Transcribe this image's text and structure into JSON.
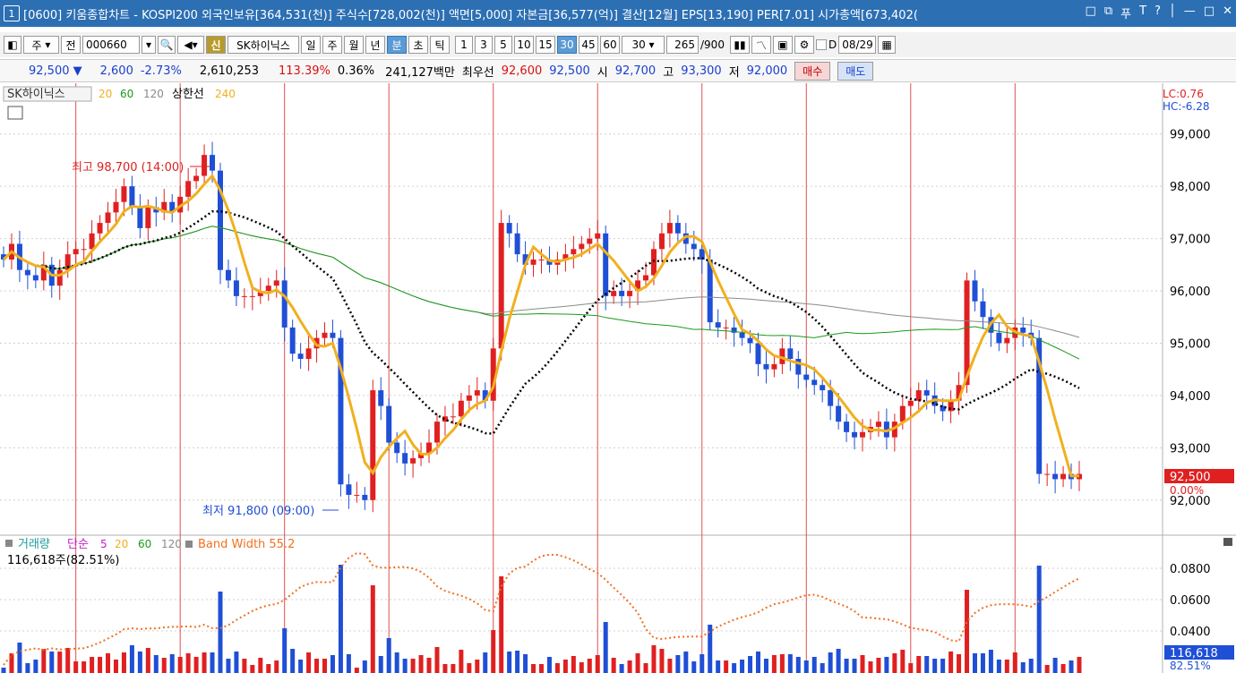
{
  "title_bar": {
    "screen_number": "1",
    "text": "[0600] 키움종합차트 - KOSPI200 외국인보유[364,531(천)] 주식수[728,002(천)] 액면[5,000] 자본금[36,577(억)] 결산[12월] EPS[13,190] PER[7.01] 시가총액[673,402(",
    "icons": [
      "□",
      "⧉",
      "푸",
      "T",
      "?",
      "│",
      "—",
      "□",
      "✕"
    ]
  },
  "toolbar": {
    "period_select": "주",
    "prev_label": "전",
    "stock_code": "000660",
    "new_label": "신",
    "stock_name": "SK하이닉스",
    "periods": [
      "일",
      "주",
      "월",
      "년",
      "분",
      "초",
      "틱"
    ],
    "selected_period": "분",
    "intervals": [
      "1",
      "3",
      "5",
      "10",
      "15",
      "30",
      "45",
      "60"
    ],
    "selected_interval": "30",
    "interval_select": "30",
    "count": "265",
    "count_total": "/900",
    "date_checkbox_label": "D",
    "date": "08/29"
  },
  "quote_bar": {
    "price": "92,500 ▼",
    "change": "2,600",
    "change_pct": "-2.73%",
    "volume": "2,610,253",
    "volume_ratio": "113.39%",
    "turnover": "0.36%",
    "amount": "241,127백만",
    "best_label": "최우선",
    "ask": "92,600",
    "bid": "92,500",
    "open_label": "시",
    "open": "92,700",
    "high_label": "고",
    "high": "93,300",
    "low_label": "저",
    "low": "92,000",
    "buy_button": "매수",
    "sell_button": "매도"
  },
  "price_panel": {
    "legend_name": "SK하이닉스",
    "legend_ma": [
      "20",
      "60",
      "120"
    ],
    "legend_limit": "상한선",
    "legend_limit_value": "240",
    "lc": "LC:0.76",
    "hc": "HC:-6.28",
    "high_annotation": "최고 98,700 (14:00)",
    "low_annotation": "최저 91,800 (09:00)",
    "current_price_tag": "92,500",
    "current_pct_tag": "0.00%",
    "colors": {
      "up": "#e02020",
      "down": "#1f4fd6",
      "ma_gold": "#f0b020",
      "ma_black": "#000000",
      "ma_green": "#1a9a1a",
      "ma_gray": "#8a8a8a"
    }
  },
  "volume_panel": {
    "legend_name": "거래량",
    "legend_simple": "단순",
    "legend_ma": [
      "5",
      "20",
      "60",
      "120"
    ],
    "legend_bw": "Band Width 55.2",
    "volume_value": "116,618주(82.51%)",
    "current_volume_tag": "116,618",
    "current_pct_tag": "82.51%"
  },
  "chart_data": {
    "type": "line",
    "price_axis": {
      "ticks": [
        "99,000",
        "98,000",
        "97,000",
        "96,000",
        "95,000",
        "94,000",
        "93,000",
        "92,000"
      ],
      "ylim": [
        91500,
        99800
      ]
    },
    "bandwidth_axis": {
      "ticks": [
        "0.0800",
        "0.0600",
        "0.0400"
      ]
    },
    "close": [
      96600,
      96900,
      96400,
      96300,
      96200,
      96500,
      96100,
      96400,
      96700,
      96800,
      96800,
      97100,
      97300,
      97500,
      97700,
      98000,
      97600,
      97200,
      97600,
      97500,
      97700,
      97500,
      97800,
      98100,
      98200,
      98600,
      98300,
      96400,
      96200,
      95900,
      95900,
      95900,
      96000,
      96100,
      96200,
      95300,
      94800,
      94700,
      94900,
      95100,
      95200,
      95100,
      92300,
      92100,
      92100,
      92000,
      94100,
      93800,
      93100,
      92900,
      92700,
      92800,
      92900,
      93100,
      93500,
      93600,
      93600,
      93900,
      94000,
      94100,
      93900,
      94900,
      97300,
      97100,
      96700,
      96500,
      96600,
      96600,
      96500,
      96600,
      96700,
      96800,
      96900,
      97000,
      97100,
      95900,
      96000,
      95900,
      96000,
      96200,
      96300,
      96800,
      97100,
      97300,
      97100,
      96900,
      96800,
      96600,
      95400,
      95300,
      95300,
      95200,
      95100,
      95000,
      94600,
      94500,
      94600,
      94900,
      94700,
      94400,
      94300,
      94200,
      94100,
      93800,
      93500,
      93300,
      93200,
      93300,
      93400,
      93500,
      93200,
      93500,
      93800,
      93900,
      94100,
      94000,
      93800,
      93700,
      93900,
      94200,
      96200,
      95800,
      95500,
      95200,
      95000,
      95100,
      95300,
      95200,
      95100,
      92500,
      92500,
      92400,
      92500,
      92400,
      92500
    ]
  }
}
